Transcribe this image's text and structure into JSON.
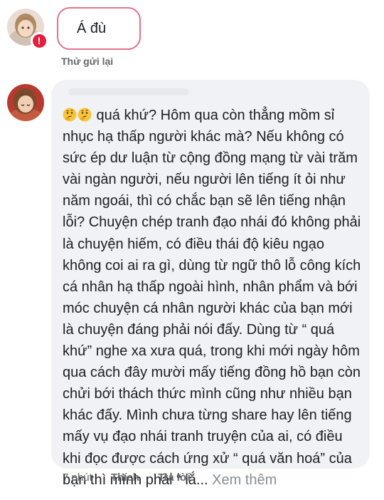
{
  "failed_message": {
    "text": "Á đù",
    "retry_label": "Thử gửi lại",
    "error_icon": "exclamation-icon",
    "border_color": "#e8708a",
    "badge_color": "#e41e3f"
  },
  "comment": {
    "emojis": [
      "thinking-face-icon",
      "thinking-face-icon"
    ],
    "body": " quá khứ? Hôm qua còn thẳng mồm sỉ nhục hạ thấp người khác mà? Nếu không có sức ép dư luận từ cộng đồng mạng từ vài trăm vài ngàn người, nếu người lên tiếng ít ỏi như năm ngoái, thì có chắc bạn sẽ lên tiếng nhận lỗi? Chuyện chép tranh đạo nhái đó không phải là chuyện hiếm, có điều thái độ kiêu ngạo không coi ai ra gì, dùng từ ngữ thô lỗ công kích cá nhân hạ thấp ngoài hình, nhân phẩm và bới móc chuyện cá nhân người khác của bạn mới là chuyện đáng phải nói đấy. Dùng từ “ quá khứ” nghe xa xưa quá, trong khi mới ngày hôm qua cách đây mười mấy tiếng đồng hồ bạn còn chửi bới thách thức mình cũng như nhiều bạn khác đấy. Mình chưa từng share hay lên tiếng mấy vụ đạo nhái tranh truyện của ai, có điều khi đọc được cách ứng xử “ quá văn hoá” của bạn thì mình phải “ lắ...",
    "see_more_label": " Xem thêm",
    "bubble_color": "#f0f2f5"
  },
  "actions": {
    "time": "7 phút",
    "like_label": "Thích",
    "reply_label": "Trả lời"
  }
}
